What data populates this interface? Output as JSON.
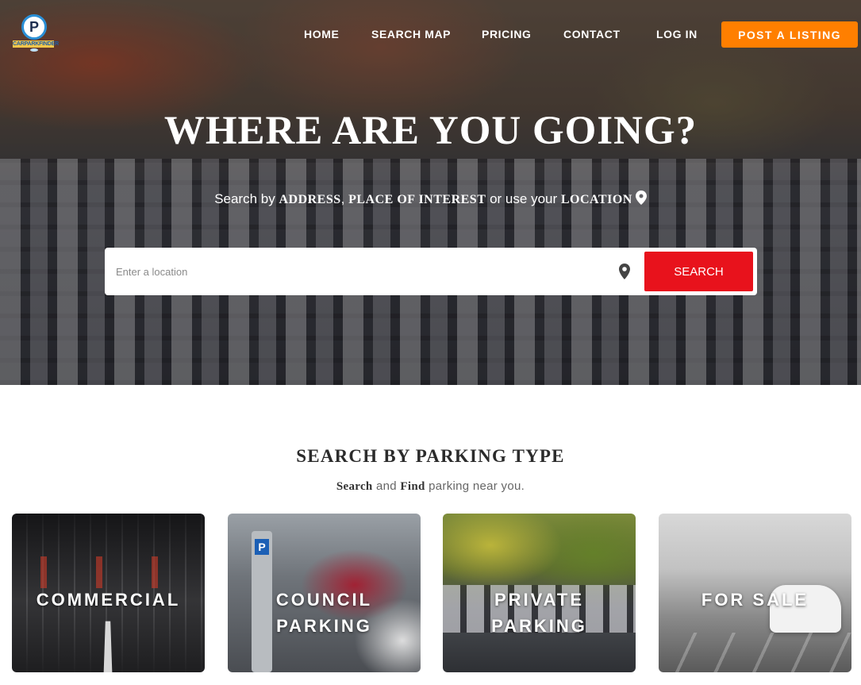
{
  "brand": {
    "logo_letter": "P",
    "logo_text": "CARPARKFINDER"
  },
  "nav": {
    "home": "HOME",
    "search_map": "SEARCH MAP",
    "pricing": "PRICING",
    "contact": "CONTACT",
    "login": "LOG IN",
    "post_listing": "POST A LISTING"
  },
  "hero": {
    "headline": "WHERE ARE YOU GOING?",
    "sub_prefix": "Search by ",
    "sub_address": "ADDRESS",
    "sub_comma": ", ",
    "sub_poi": "PLACE OF INTEREST",
    "sub_mid": " or use your ",
    "sub_location": "LOCATION",
    "location_icon": "map-pin-icon"
  },
  "search": {
    "placeholder": "Enter a location",
    "value": "",
    "button_label": "SEARCH",
    "locate_icon": "map-pin-icon"
  },
  "section": {
    "title": "SEARCH BY PARKING TYPE",
    "sub_search": "Search",
    "sub_and": " and ",
    "sub_find": "Find",
    "sub_rest": " parking near you."
  },
  "cards": [
    {
      "label": "COMMERCIAL"
    },
    {
      "label": "COUNCIL PARKING"
    },
    {
      "label": "PRIVATE PARKING"
    },
    {
      "label": "FOR SALE"
    }
  ],
  "colors": {
    "post_button": "#ff7f00",
    "search_button": "#e8121c",
    "logo_ring": "#2a8fd6"
  }
}
